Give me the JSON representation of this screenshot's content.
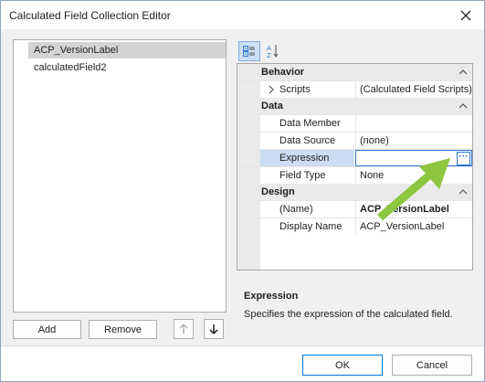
{
  "window": {
    "title": "Calculated Field Collection Editor"
  },
  "list": {
    "items": [
      "ACP_VersionLabel",
      "calculatedField2"
    ],
    "selected_index": 0
  },
  "list_buttons": {
    "add": "Add",
    "remove": "Remove"
  },
  "grid": {
    "categories": [
      {
        "label": "Behavior",
        "props": [
          {
            "name": "Scripts",
            "value": "(Calculated Field Scripts)"
          }
        ]
      },
      {
        "label": "Data",
        "props": [
          {
            "name": "Data Member",
            "value": ""
          },
          {
            "name": "Data Source",
            "value": "(none)"
          },
          {
            "name": "Expression",
            "value": ""
          },
          {
            "name": "Field Type",
            "value": "None"
          }
        ]
      },
      {
        "label": "Design",
        "props": [
          {
            "name": "(Name)",
            "value": "ACP_VersionLabel"
          },
          {
            "name": "Display Name",
            "value": "ACP_VersionLabel"
          }
        ]
      }
    ],
    "ellipsis": "···"
  },
  "description": {
    "title": "Expression",
    "text": "Specifies the expression of the calculated field."
  },
  "footer": {
    "ok": "OK",
    "cancel": "Cancel"
  },
  "colors": {
    "accent": "#2e76c9",
    "annotation_arrow": "#8dc63f"
  },
  "icons": [
    "close-icon",
    "categorized-icon",
    "alphabetical-icon",
    "arrow-up-icon",
    "arrow-down-icon",
    "chevron-up-icon",
    "chevron-right-icon"
  ]
}
